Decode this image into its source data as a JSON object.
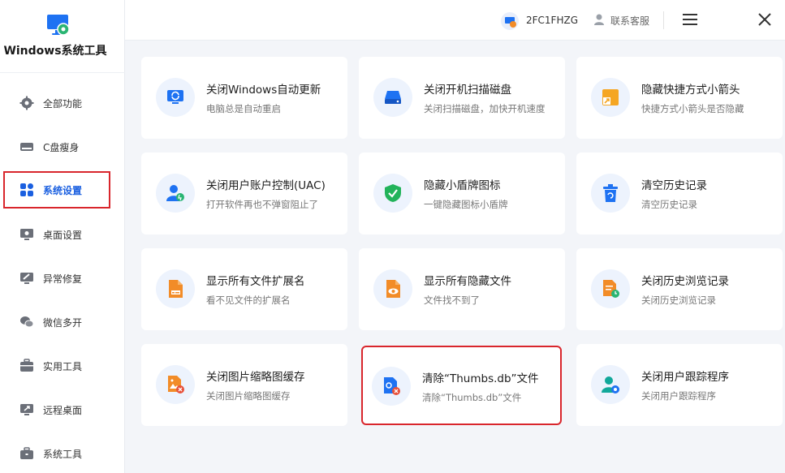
{
  "app": {
    "title": "Windows系统工具"
  },
  "topbar": {
    "user_id": "2FC1FHZG",
    "customer_service": "联系客服"
  },
  "sidebar": {
    "items": [
      {
        "label": "全部功能",
        "icon": "gear-icon"
      },
      {
        "label": "C盘瘦身",
        "icon": "drive-icon"
      },
      {
        "label": "系统设置",
        "icon": "grid-icon",
        "active": true
      },
      {
        "label": "桌面设置",
        "icon": "monitor-gear-icon"
      },
      {
        "label": "异常修复",
        "icon": "wrench-icon"
      },
      {
        "label": "微信多开",
        "icon": "wechat-icon"
      },
      {
        "label": "实用工具",
        "icon": "toolbox-icon"
      },
      {
        "label": "远程桌面",
        "icon": "remote-desktop-icon"
      },
      {
        "label": "系统工具",
        "icon": "briefcase-icon"
      }
    ]
  },
  "cards": [
    {
      "title": "关闭Windows自动更新",
      "desc": "电脑总是自动重启",
      "icon": "windows-update-icon"
    },
    {
      "title": "关闭开机扫描磁盘",
      "desc": "关闭扫描磁盘，加快开机速度",
      "icon": "disk-scan-icon"
    },
    {
      "title": "隐藏快捷方式小箭头",
      "desc": "快捷方式小箭头是否隐藏",
      "icon": "shortcut-arrow-icon"
    },
    {
      "title": "关闭用户账户控制(UAC)",
      "desc": "打开软件再也不弹窗阻止了",
      "icon": "uac-user-icon"
    },
    {
      "title": "隐藏小盾牌图标",
      "desc": "一键隐藏图标小盾牌",
      "icon": "shield-check-icon"
    },
    {
      "title": "清空历史记录",
      "desc": "清空历史记录",
      "icon": "trash-icon"
    },
    {
      "title": "显示所有文件扩展名",
      "desc": "看不见文件的扩展名",
      "icon": "file-extension-icon"
    },
    {
      "title": "显示所有隐藏文件",
      "desc": "文件找不到了",
      "icon": "hidden-file-eye-icon"
    },
    {
      "title": "关闭历史浏览记录",
      "desc": "关闭历史浏览记录",
      "icon": "history-document-icon"
    },
    {
      "title": "关闭图片缩略图缓存",
      "desc": "关闭图片缩略图缓存",
      "icon": "image-cache-icon"
    },
    {
      "title": "清除“Thumbs.db”文件",
      "desc": "清除“Thumbs.db”文件",
      "icon": "thumbs-db-file-icon",
      "highlighted": true
    },
    {
      "title": "关闭用户跟踪程序",
      "desc": "关闭用户跟踪程序",
      "icon": "user-tracking-icon"
    }
  ],
  "colors": {
    "accent": "#1a5fe0",
    "highlight_border": "#d9262c",
    "background": "#f3f5f9"
  }
}
